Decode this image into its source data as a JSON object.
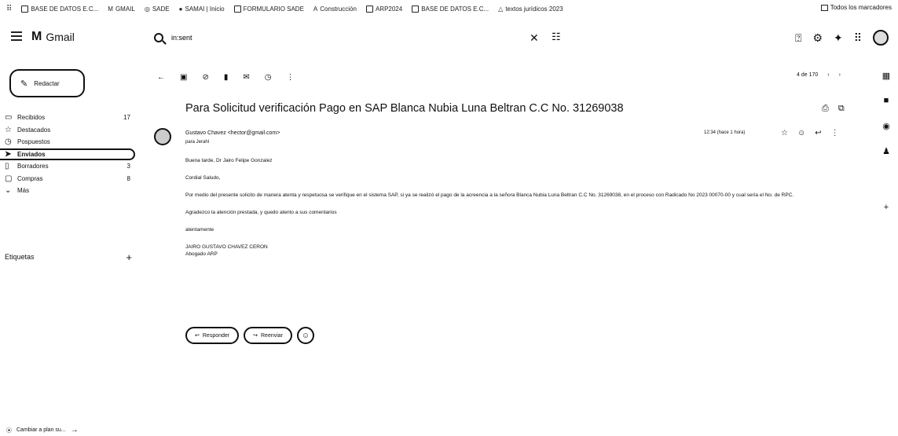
{
  "bookmarks": {
    "items": [
      {
        "label": "BASE DE DATOS E.C..."
      },
      {
        "label": "GMAIL"
      },
      {
        "label": "SADE"
      },
      {
        "label": "SAMAI | Inicio"
      },
      {
        "label": "FORMULARIO SADE"
      },
      {
        "label": "Construcción"
      },
      {
        "label": "ARP2024"
      },
      {
        "label": "BASE DE DATOS E.C..."
      },
      {
        "label": "textos jurídicos 2023"
      }
    ],
    "all_label": "Todos los marcadores"
  },
  "header": {
    "app_name": "Gmail",
    "search_value": "in:sent"
  },
  "sidebar": {
    "compose_label": "Redactar",
    "items": [
      {
        "label": "Recibidos",
        "count": "17",
        "icon": "inbox-icon"
      },
      {
        "label": "Destacados",
        "count": "",
        "icon": "star-icon"
      },
      {
        "label": "Pospuestos",
        "count": "",
        "icon": "clock-icon"
      },
      {
        "label": "Enviados",
        "count": "",
        "icon": "send-icon"
      },
      {
        "label": "Borradores",
        "count": "3",
        "icon": "draft-icon"
      },
      {
        "label": "Compras",
        "count": "8",
        "icon": "tag-icon"
      },
      {
        "label": "Más",
        "count": "",
        "icon": "chevron-down-icon"
      }
    ],
    "labels_title": "Etiquetas",
    "plan_text": "Cambiar a plan su..."
  },
  "toolbar": {
    "pager": "4 de 170"
  },
  "email": {
    "subject": "Para Solicitud verificación Pago en SAP Blanca Nubia Luna Beltran C.C No. 31269038",
    "sender": "Gustavo Chavez <hector@gmail.com>",
    "to": "para Jerahl",
    "time": "12:34 (hace 1 hora)",
    "body": [
      "Buena tarde, Dr Jairo Felipe Gonzalez",
      "Cordial Saludo,",
      "Por medio del presente solicito de manera atenta y respetuosa se verifique en el sistema SAP, si ya se realizó el pago de la acreencia a la señora Blanca Nubia Luna Beltran C.C No. 31269038, en el proceso con Radicado No 2023 00070-00 y cual sería el No. de RPC.",
      "Agradezco la atención prestada, y quedo atento a sus comentarios",
      "atentamente"
    ],
    "signature_name": "JAIRO GUSTAVO CHAVEZ CERON",
    "signature_role": "Abogado ARP",
    "reply_label": "Responder",
    "forward_label": "Reenviar"
  }
}
